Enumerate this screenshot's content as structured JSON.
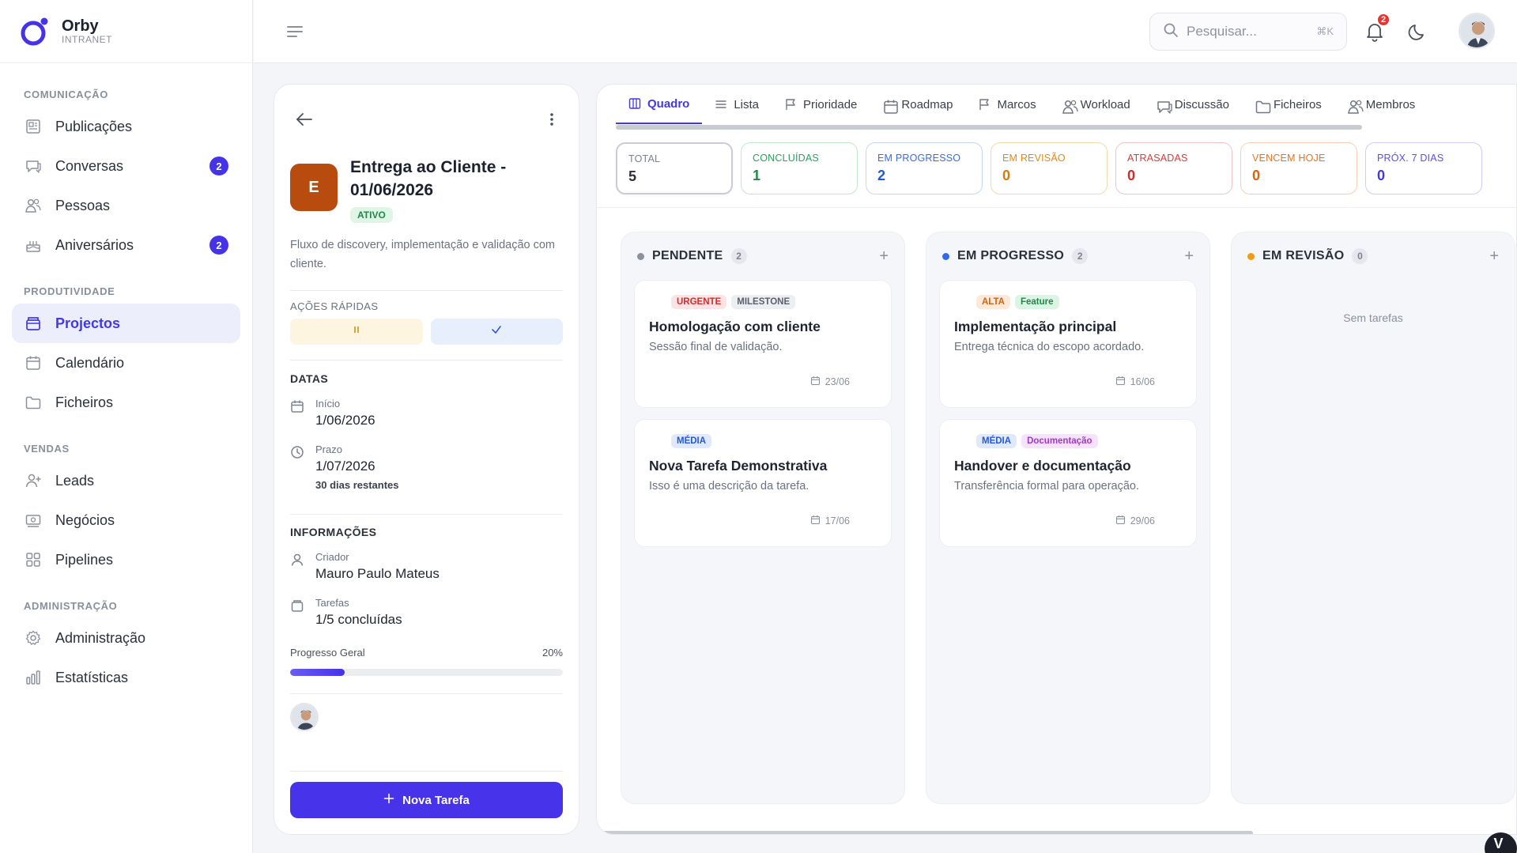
{
  "brand": {
    "name": "Orby",
    "sub": "INTRANET",
    "accent": "#4433e8"
  },
  "sidebar": {
    "sections": [
      {
        "label": "COMUNICAÇÃO",
        "items": [
          {
            "label": "Publicações",
            "icon": "newspaper-icon"
          },
          {
            "label": "Conversas",
            "icon": "chat-icon",
            "badge": "2"
          },
          {
            "label": "Pessoas",
            "icon": "users-icon"
          },
          {
            "label": "Aniversários",
            "icon": "cake-icon",
            "badge": "2"
          }
        ]
      },
      {
        "label": "PRODUTIVIDADE",
        "items": [
          {
            "label": "Projectos",
            "icon": "projects-icon",
            "active": true
          },
          {
            "label": "Calendário",
            "icon": "calendar-icon"
          },
          {
            "label": "Ficheiros",
            "icon": "folder-icon"
          }
        ]
      },
      {
        "label": "VENDAS",
        "items": [
          {
            "label": "Leads",
            "icon": "user-plus-icon"
          },
          {
            "label": "Negócios",
            "icon": "money-icon"
          },
          {
            "label": "Pipelines",
            "icon": "grid-icon"
          }
        ]
      },
      {
        "label": "ADMINISTRAÇÃO",
        "items": [
          {
            "label": "Administração",
            "icon": "gear-icon"
          },
          {
            "label": "Estatísticas",
            "icon": "bar-chart-icon"
          }
        ]
      }
    ]
  },
  "topbar": {
    "search_placeholder": "Pesquisar...",
    "search_shortcut": "⌘K",
    "notifications_count": "2"
  },
  "project": {
    "avatar_letter": "E",
    "title": "Entrega ao Cliente - 01/06/2026",
    "status": "ATIVO",
    "description": "Fluxo de discovery, implementação e validação com cliente.",
    "quick_actions_label": "AÇÕES RÁPIDAS",
    "dates_label": "DATAS",
    "start_label": "Início",
    "start_value": "1/06/2026",
    "deadline_label": "Prazo",
    "deadline_value": "1/07/2026",
    "remaining": "30 dias restantes",
    "info_label": "INFORMAÇÕES",
    "creator_label": "Criador",
    "creator_value": "Mauro Paulo Mateus",
    "tasks_label": "Tarefas",
    "tasks_value": "1/5 concluídas",
    "progress_label": "Progresso Geral",
    "progress_text": "20%",
    "progress": 0.2,
    "new_task_label": "Nova Tarefa"
  },
  "tabs": [
    {
      "label": "Quadro",
      "icon": "columns-icon",
      "active": true
    },
    {
      "label": "Lista",
      "icon": "list-icon"
    },
    {
      "label": "Prioridade",
      "icon": "flag-icon"
    },
    {
      "label": "Roadmap",
      "icon": "calendar-icon"
    },
    {
      "label": "Marcos",
      "icon": "flag-icon"
    },
    {
      "label": "Workload",
      "icon": "users-icon"
    },
    {
      "label": "Discussão",
      "icon": "chat-icon"
    },
    {
      "label": "Ficheiros",
      "icon": "folder-icon"
    },
    {
      "label": "Membros",
      "icon": "users-icon"
    }
  ],
  "stats": [
    {
      "label": "TOTAL",
      "value": "5",
      "color": "#2b303b",
      "label_color": "#7d828e",
      "border": "#c9ccd6",
      "bg": "#fff"
    },
    {
      "label": "CONCLUÍDAS",
      "value": "1",
      "color": "#1e8a47",
      "label_color": "#28a35a",
      "border": "#bfe8cd",
      "bg": "#fff"
    },
    {
      "label": "EM PROGRESSO",
      "value": "2",
      "color": "#2458d8",
      "label_color": "#3a6be0",
      "border": "#c6d6f6",
      "bg": "#fff"
    },
    {
      "label": "EM REVISÃO",
      "value": "0",
      "color": "#d67a0c",
      "label_color": "#e28a12",
      "border": "#f5d9a6",
      "bg": "#fff"
    },
    {
      "label": "ATRASADAS",
      "value": "0",
      "color": "#d42b2b",
      "label_color": "#d83a3a",
      "border": "#f4c4c4",
      "bg": "#fff"
    },
    {
      "label": "VENCEM HOJE",
      "value": "0",
      "color": "#e0620d",
      "label_color": "#e8731c",
      "border": "#f6d0b4",
      "bg": "#fff"
    },
    {
      "label": "PRÓX. 7 DIAS",
      "value": "0",
      "color": "#4338e6",
      "label_color": "#5a50ea",
      "border": "#cfcdf7",
      "bg": "#fff"
    }
  ],
  "columns": [
    {
      "title": "PENDENTE",
      "count": "2",
      "dot": "#8b909c",
      "cards": [
        {
          "tags": [
            {
              "text": "URGENTE",
              "fg": "#d42b2b",
              "bg": "#fde3e3"
            },
            {
              "text": "MILESTONE",
              "fg": "#5b606b",
              "bg": "#eceef2"
            }
          ],
          "title": "Homologação com cliente",
          "desc": "Sessão final de validação.",
          "date": "23/06"
        },
        {
          "tags": [
            {
              "text": "MÉDIA",
              "fg": "#2458d8",
              "bg": "#dfe9fb"
            }
          ],
          "title": "Nova Tarefa Demonstrativa",
          "desc": "Isso é uma descrição da tarefa.",
          "date": "17/06"
        }
      ]
    },
    {
      "title": "EM PROGRESSO",
      "count": "2",
      "dot": "#2f6be6",
      "cards": [
        {
          "tags": [
            {
              "text": "ALTA",
              "fg": "#d6620c",
              "bg": "#fde9d9"
            },
            {
              "text": "Feature",
              "fg": "#1e8a47",
              "bg": "#dcf4e4"
            }
          ],
          "title": "Implementação principal",
          "desc": "Entrega técnica do escopo acordado.",
          "date": "16/06"
        },
        {
          "tags": [
            {
              "text": "MÉDIA",
              "fg": "#2458d8",
              "bg": "#dfe9fb"
            },
            {
              "text": "Documentação",
              "fg": "#a336c8",
              "bg": "#f5e3fb"
            }
          ],
          "title": "Handover e documentação",
          "desc": "Transferência formal para operação.",
          "date": "29/06"
        }
      ]
    },
    {
      "title": "EM REVISÃO",
      "count": "0",
      "dot": "#f29b11",
      "cards": [],
      "empty": "Sem tarefas"
    }
  ],
  "corner_badge": "V"
}
